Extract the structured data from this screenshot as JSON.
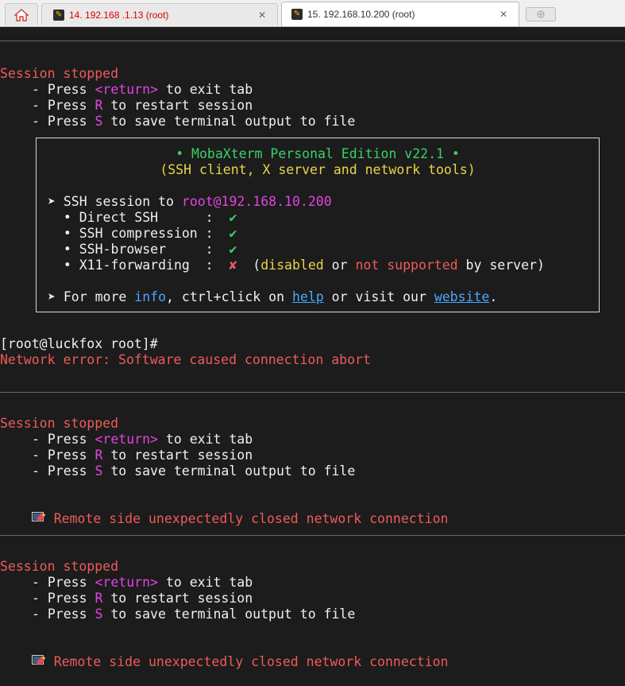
{
  "tabs": {
    "home_icon": "home-icon",
    "inactive": {
      "label": "14. 192.168 .1.13 (root)",
      "close": "✕"
    },
    "active": {
      "label": "15. 192.168.10.200 (root)",
      "close": "✕"
    },
    "new_tab_icon": "new-tab-icon"
  },
  "colors": {
    "background": "#1c1c1c",
    "error_red": "#ef5a5a",
    "key_magenta": "#e045e0",
    "check_green": "#3ad06a",
    "title_green": "#3ad06a",
    "subtitle_yellow": "#e8d64a",
    "link_blue": "#4aa8ff"
  },
  "stopped": {
    "title": "Session stopped",
    "press": "- Press ",
    "return_key": "<return>",
    "to_exit": " to exit tab",
    "r_key": "R",
    "to_restart": " to restart session",
    "s_key": "S",
    "to_save": " to save terminal output to file"
  },
  "banner": {
    "title": "• MobaXterm Personal Edition v22.1 •",
    "subtitle": "(SSH client, X server and network tools)",
    "ssh_prefix": "➤ SSH session to ",
    "ssh_target": "root@192.168.10.200",
    "items": [
      {
        "label": "  • Direct SSH      :  ",
        "mark": "✔"
      },
      {
        "label": "  • SSH compression :  ",
        "mark": "✔"
      },
      {
        "label": "  • SSH-browser     :  ",
        "mark": "✔"
      }
    ],
    "x11_label": "  • X11-forwarding  :  ",
    "x11_mark": "✘",
    "x11_open": "  (",
    "x11_disabled": "disabled",
    "x11_or": " or ",
    "x11_not": "not supported",
    "x11_close": " by server)",
    "more_prefix": "➤ For more ",
    "more_info": "info",
    "more_mid": ", ctrl+click on ",
    "more_help": "help",
    "more_or": " or visit our ",
    "more_website": "website",
    "more_end": "."
  },
  "prompt": "[root@luckfox root]#",
  "network_error": "Network error: Software caused connection abort",
  "remote_closed": "Remote side unexpectedly closed network connection"
}
